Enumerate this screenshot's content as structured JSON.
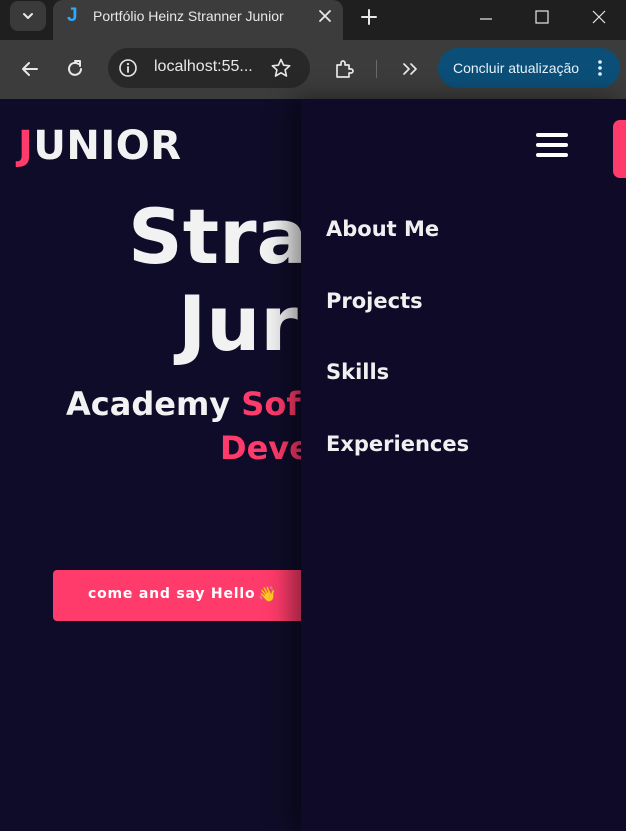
{
  "browser": {
    "tab": {
      "favicon_letter": "J",
      "title": "Portfólio Heinz Stranner Junior"
    },
    "address": {
      "url": "localhost:55..."
    },
    "update_button": {
      "label": "Concluir atualização"
    },
    "icons": {
      "tab_search": "chevron-down-icon",
      "close_tab": "close-icon",
      "new_tab": "plus-icon",
      "back": "arrow-left-icon",
      "reload": "reload-icon",
      "site_info": "info-icon",
      "bookmark": "star-icon",
      "extensions": "puzzle-icon",
      "more_tools": "double-chevron-right-icon",
      "menu": "kebab-icon"
    }
  },
  "page": {
    "logo": {
      "first_letter": "J",
      "rest": "UNIOR"
    },
    "hero": {
      "name_line1": "Stra",
      "name_line2": "Jur",
      "role_line1_white": "Academy ",
      "role_line1_pink": "Softv",
      "role_line2": "Deve",
      "cta_label": "come and say Hello",
      "cta_emoji": "👋"
    },
    "menu": {
      "items": [
        "About Me",
        "Projects",
        "Skills",
        "Experiences"
      ]
    }
  },
  "colors": {
    "background": "#0f0c29",
    "accent": "#ff3b6b",
    "drawer": "#0e0a27",
    "chrome_dark": "#1f1f1f",
    "chrome_toolbar": "#3c3c3c",
    "update_button": "#0b4f78"
  }
}
